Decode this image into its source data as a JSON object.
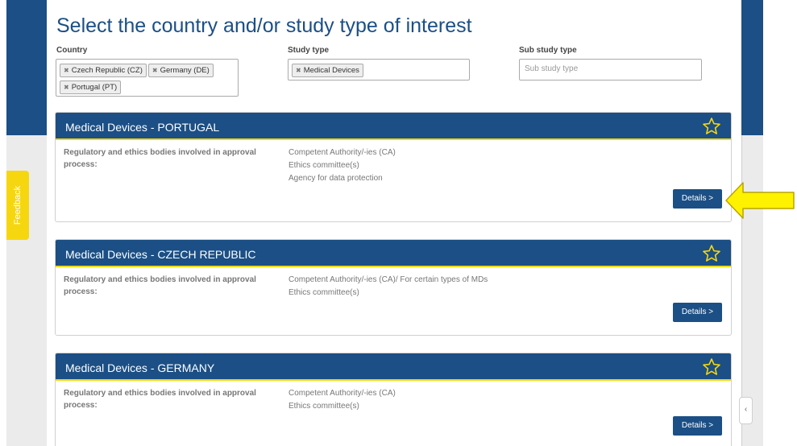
{
  "page": {
    "title": "Select the country and/or study type of interest"
  },
  "filters": {
    "country": {
      "label": "Country",
      "tags": [
        "Czech Republic (CZ)",
        "Germany (DE)",
        "Portugal (PT)"
      ]
    },
    "study_type": {
      "label": "Study type",
      "tags": [
        "Medical Devices"
      ]
    },
    "sub_study_type": {
      "label": "Sub study type",
      "placeholder": "Sub study type"
    }
  },
  "feedback": {
    "label": "Feedback"
  },
  "results": [
    {
      "title": "Medical Devices - PORTUGAL",
      "label": "Regulatory and ethics bodies involved in approval process:",
      "values": [
        "Competent Authority/-ies (CA)",
        "Ethics committee(s)",
        "Agency for data protection"
      ],
      "button": "Details >"
    },
    {
      "title": "Medical Devices - CZECH REPUBLIC",
      "label": "Regulatory and ethics bodies involved in approval process:",
      "values": [
        "Competent Authority/-ies (CA)/ For certain types of MDs",
        "Ethics committee(s)"
      ],
      "button": "Details >"
    },
    {
      "title": "Medical Devices - GERMANY",
      "label": "Regulatory and ethics bodies involved in approval process:",
      "values": [
        "Competent Authority/-ies (CA)",
        "Ethics committee(s)"
      ],
      "button": "Details >"
    }
  ],
  "colors": {
    "brand_blue": "#1b4f85",
    "accent_yellow": "#f6d70f"
  },
  "icons": {
    "favorite": "star-outline-icon",
    "tag_remove": "remove-tag-icon",
    "pointer": "arrow-left-icon"
  }
}
